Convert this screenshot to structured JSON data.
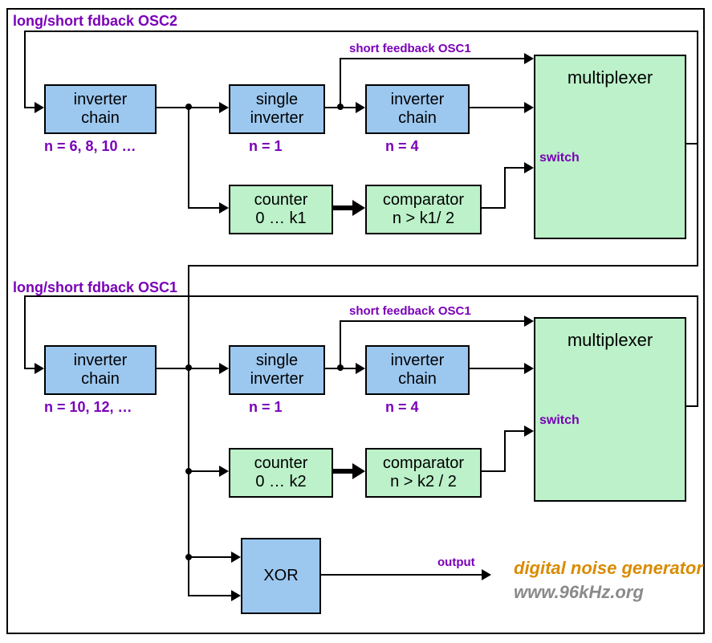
{
  "osc2": {
    "title": "long/short fdback OSC2",
    "short_fb": "short feedback OSC1",
    "inv_chain": {
      "label1": "inverter",
      "label2": "chain",
      "n": "n =  6, 8, 10 …"
    },
    "single_inv": {
      "label1": "single",
      "label2": "inverter",
      "n": "n = 1"
    },
    "inv_chain2": {
      "label1": "inverter",
      "label2": "chain",
      "n": "n =  4"
    },
    "mux": {
      "label": "multiplexer",
      "switch": "switch"
    },
    "counter": {
      "label1": "counter",
      "label2": "0 … k1"
    },
    "comparator": {
      "label1": "comparator",
      "label2": "n > k1/ 2"
    }
  },
  "osc1": {
    "title": "long/short fdback OSC1",
    "short_fb": "short feedback OSC1",
    "inv_chain": {
      "label1": "inverter",
      "label2": "chain",
      "n": "n =  10, 12, …"
    },
    "single_inv": {
      "label1": "single",
      "label2": "inverter",
      "n": "n = 1"
    },
    "inv_chain2": {
      "label1": "inverter",
      "label2": "chain",
      "n": "n = 4"
    },
    "mux": {
      "label": "multiplexer",
      "switch": "switch"
    },
    "counter": {
      "label1": "counter",
      "label2": "0 … k2"
    },
    "comparator": {
      "label1": "comparator",
      "label2": "n > k2 / 2"
    }
  },
  "xor": {
    "label": "XOR"
  },
  "output_label": "output",
  "footer": {
    "line1": "digital noise generator",
    "line2": "www.96kHz.org"
  }
}
